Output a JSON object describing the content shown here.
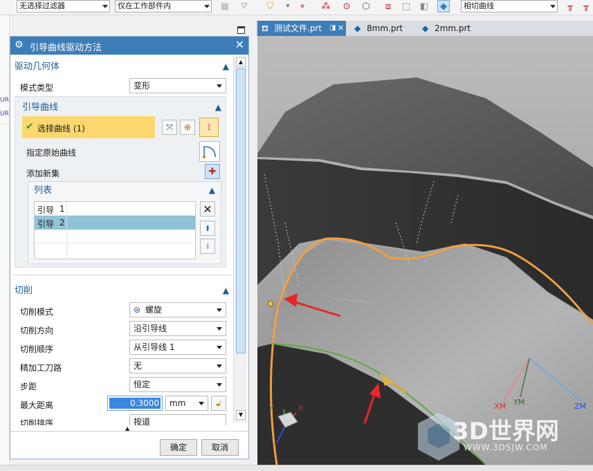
{
  "toolbar": {
    "filter_select": "无选择过滤器",
    "scope_select": "仅在工作部件内",
    "curve_rule_select": "相切曲线"
  },
  "left_strip": {
    "rows": [
      "UR",
      "UR"
    ]
  },
  "tabs": [
    {
      "label": "测试文件.prt",
      "active": true
    },
    {
      "label": "8mm.prt",
      "active": false
    },
    {
      "label": "2mm.prt",
      "active": false
    }
  ],
  "dialog": {
    "title": "引导曲线驱动方法",
    "drive_geometry": {
      "header": "驱动几何体",
      "mode_type_label": "模式类型",
      "mode_type_value": "变形",
      "guide_curve": {
        "header": "引导曲线",
        "select_curve": "选择曲线 (1)",
        "specify_original": "指定原始曲线",
        "add_new_set": "添加新集",
        "list": {
          "header": "列表",
          "rows": [
            {
              "name": "引导",
              "index": "1",
              "selected": false
            },
            {
              "name": "引导",
              "index": "2",
              "selected": true
            }
          ]
        }
      }
    },
    "cut": {
      "header": "切削",
      "rows": [
        {
          "label": "切削模式",
          "value": "螺旋",
          "icon": "spiral-icon"
        },
        {
          "label": "切削方向",
          "value": "沿引导线"
        },
        {
          "label": "切削顺序",
          "value": "从引导线 1"
        },
        {
          "label": "精加工刀路",
          "value": "无"
        },
        {
          "label": "步距",
          "value": "恒定"
        },
        {
          "label": "最大距离",
          "value": "0.3000",
          "unit": "mm"
        },
        {
          "label": "切削排序",
          "value": "按道"
        }
      ]
    },
    "ok_label": "确定",
    "cancel_label": "取消"
  },
  "viewport": {
    "axes_bottom_left": {
      "y": "Y",
      "x": "X"
    },
    "axes_right": {
      "xm": "XM",
      "ym": "YM",
      "zm": "ZM"
    },
    "watermark": {
      "brand": "3D世界网",
      "url": "WWW.3DSJW.COM"
    }
  },
  "colors": {
    "title_blue": "#3d7eb8",
    "section_blue": "#1f5d95",
    "selection_yellow": "#fcd86f",
    "list_selected": "#8fc3d6",
    "curve_orange": "#f0a040",
    "arrow_red": "#e8262a",
    "edge_green": "#5fa844"
  }
}
